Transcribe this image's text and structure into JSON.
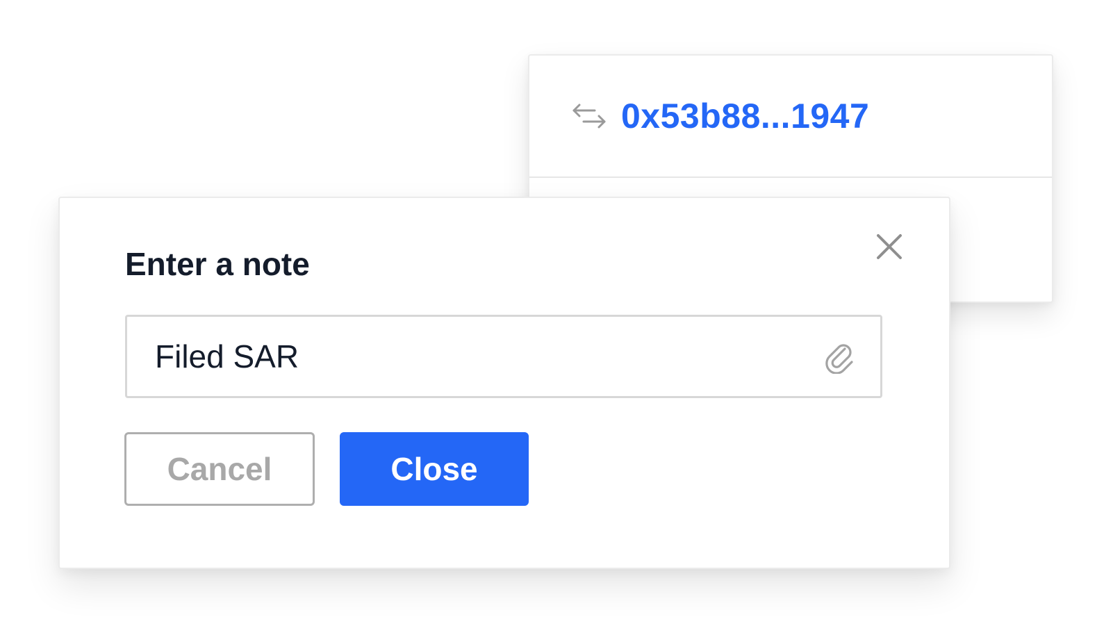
{
  "transaction": {
    "icon": "transfer-arrows-icon",
    "hash": "0x53b88...1947",
    "link_color": "#2467f6"
  },
  "modal": {
    "title": "Enter a note",
    "close_icon": "close-icon",
    "note": {
      "value": "Filed SAR",
      "attach_icon": "paperclip-icon"
    },
    "buttons": {
      "cancel_label": "Cancel",
      "close_label": "Close"
    },
    "primary_color": "#2467f6"
  }
}
